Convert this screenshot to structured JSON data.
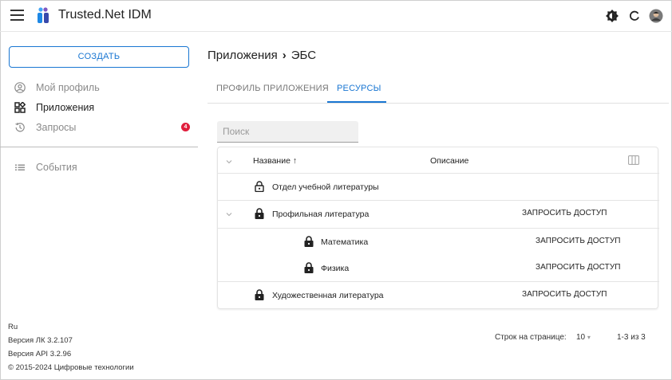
{
  "header": {
    "app_title": "Trusted.Net IDM"
  },
  "sidebar": {
    "create_label": "СОЗДАТЬ",
    "items": [
      {
        "label": "Мой профиль",
        "icon": "account-circle-icon"
      },
      {
        "label": "Приложения",
        "icon": "apps-icon"
      },
      {
        "label": "Запросы",
        "icon": "history-icon",
        "badge": "4"
      },
      {
        "label": "События",
        "icon": "list-icon"
      }
    ],
    "footer": {
      "language": "Ru",
      "lk_version": "Версия ЛК 3.2.107",
      "api_version": "Версия API 3.2.96",
      "copyright": "© 2015-2024 Цифровые технологии"
    }
  },
  "main": {
    "breadcrumb": {
      "parent": "Приложения",
      "separator": "›",
      "current": "ЭБС"
    },
    "tabs": [
      {
        "label": "ПРОФИЛЬ ПРИЛОЖЕНИЯ",
        "active": false
      },
      {
        "label": "РЕСУРСЫ",
        "active": true
      }
    ],
    "search": {
      "placeholder": "Поиск",
      "value": ""
    },
    "table": {
      "columns": {
        "name": "Название",
        "sort_arrow": "↑",
        "description": "Описание"
      },
      "rows": [
        {
          "name": "Отдел учебной литературы",
          "action": "",
          "lock": "unlocked"
        },
        {
          "name": "Профильная литература",
          "action": "ЗАПРОСИТЬ ДОСТУП",
          "lock": "locked",
          "expanded": true
        },
        {
          "name": "Математика",
          "action": "ЗАПРОСИТЬ ДОСТУП",
          "lock": "locked"
        },
        {
          "name": "Физика",
          "action": "ЗАПРОСИТЬ ДОСТУП",
          "lock": "locked"
        },
        {
          "name": "Художественная литература",
          "action": "ЗАПРОСИТЬ ДОСТУП",
          "lock": "locked"
        }
      ]
    },
    "pagination": {
      "rows_per_page_label": "Строк на странице:",
      "rows_per_page_value": "10",
      "range": "1-3 из 3"
    }
  },
  "colors": {
    "accent": "#1976d2",
    "badge": "#e01e3c"
  }
}
